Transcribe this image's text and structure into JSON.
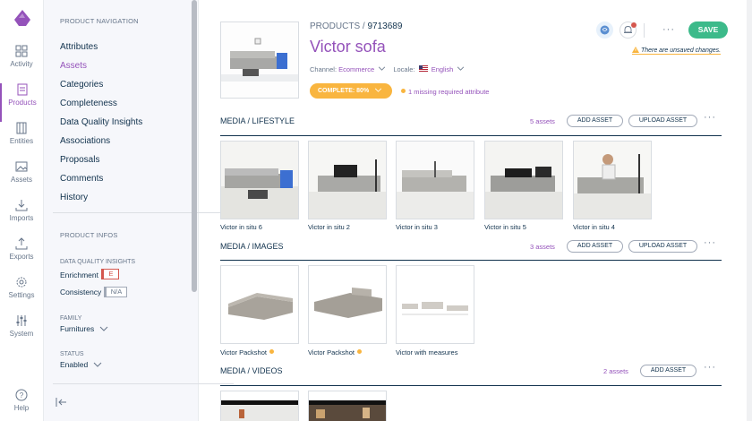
{
  "rail": {
    "items": [
      {
        "label": "Activity",
        "icon": "dashboard-icon"
      },
      {
        "label": "Products",
        "icon": "products-icon"
      },
      {
        "label": "Entities",
        "icon": "entities-icon"
      },
      {
        "label": "Assets",
        "icon": "assets-icon"
      },
      {
        "label": "Imports",
        "icon": "imports-icon"
      },
      {
        "label": "Exports",
        "icon": "exports-icon"
      },
      {
        "label": "Settings",
        "icon": "settings-icon"
      },
      {
        "label": "System",
        "icon": "system-icon"
      },
      {
        "label": "Help",
        "icon": "help-icon"
      }
    ],
    "active": "Products"
  },
  "nav": {
    "heading": "Product navigation",
    "links": [
      "Attributes",
      "Assets",
      "Categories",
      "Completeness",
      "Data Quality Insights",
      "Associations",
      "Proposals",
      "Comments",
      "History"
    ],
    "active": "Assets",
    "infos_heading": "Product infos",
    "dqi_heading": "Data quality insights",
    "enrichment_label": "Enrichment",
    "enrichment_grade": "E",
    "consistency_label": "Consistency",
    "consistency_grade": "N/A",
    "family_heading": "Family",
    "family_value": "Furnitures",
    "status_heading": "Status",
    "status_value": "Enabled"
  },
  "header": {
    "breadcrumb_root": "PRODUCTS",
    "breadcrumb_sep": "/",
    "product_id": "9713689",
    "title": "Victor sofa",
    "channel_label": "Channel:",
    "channel_value": "Ecommerce",
    "locale_label": "Locale:",
    "locale_value": "English",
    "complete_label": "COMPLETE: 80%",
    "completeness_percent": 80,
    "missing_text": "1 missing required attribute",
    "save_label": "SAVE",
    "more_label": "···",
    "unsaved_text": "There are unsaved changes."
  },
  "sections": [
    {
      "title": "MEDIA / LIFESTYLE",
      "count": "5 assets",
      "buttons": [
        "ADD ASSET",
        "UPLOAD ASSET"
      ],
      "assets": [
        {
          "label": "Victor in situ 6",
          "warn": false
        },
        {
          "label": "Victor in situ 2",
          "warn": false
        },
        {
          "label": "Victor in situ 3",
          "warn": false
        },
        {
          "label": "Victor in situ 5",
          "warn": false
        },
        {
          "label": "Victor in situ 4",
          "warn": false
        }
      ]
    },
    {
      "title": "MEDIA / IMAGES",
      "count": "3 assets",
      "buttons": [
        "ADD ASSET",
        "UPLOAD ASSET"
      ],
      "assets": [
        {
          "label": "Victor Packshot",
          "warn": true
        },
        {
          "label": "Victor Packshot",
          "warn": true
        },
        {
          "label": "Victor with measures",
          "warn": false
        }
      ]
    },
    {
      "title": "MEDIA / VIDEOS",
      "count": "2 assets",
      "buttons": [
        "ADD ASSET"
      ],
      "assets": [
        {
          "label": "",
          "warn": false
        },
        {
          "label": "",
          "warn": false
        }
      ]
    }
  ],
  "colors": {
    "brand": "#9452ba",
    "save": "#3cba8a",
    "warning": "#f9b53f",
    "grade_e": "#d4574e"
  }
}
